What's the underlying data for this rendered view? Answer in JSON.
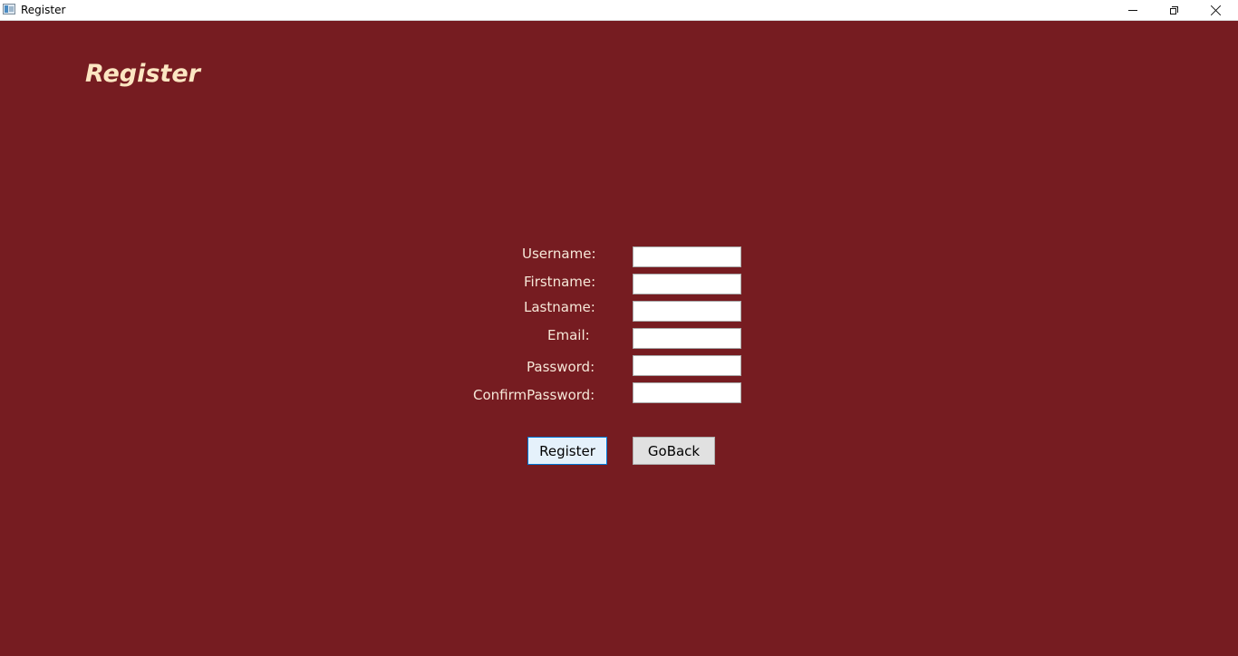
{
  "window": {
    "title": "Register",
    "controls": {
      "minimize": "minimize",
      "restore": "restore",
      "close": "close"
    }
  },
  "page": {
    "heading": "Register",
    "colors": {
      "background": "#761C21",
      "heading": "#FCE6C2",
      "label": "#F6E7D8"
    }
  },
  "form": {
    "username": {
      "label": "Username:",
      "value": ""
    },
    "firstname": {
      "label": "Firstname:",
      "value": ""
    },
    "lastname": {
      "label": "Lastname:",
      "value": ""
    },
    "email": {
      "label": "Email:",
      "value": ""
    },
    "password": {
      "label": "Password:",
      "value": ""
    },
    "confirm_password": {
      "label": "ConfirmPassword:",
      "value": ""
    }
  },
  "buttons": {
    "register": "Register",
    "goback": "GoBack"
  }
}
